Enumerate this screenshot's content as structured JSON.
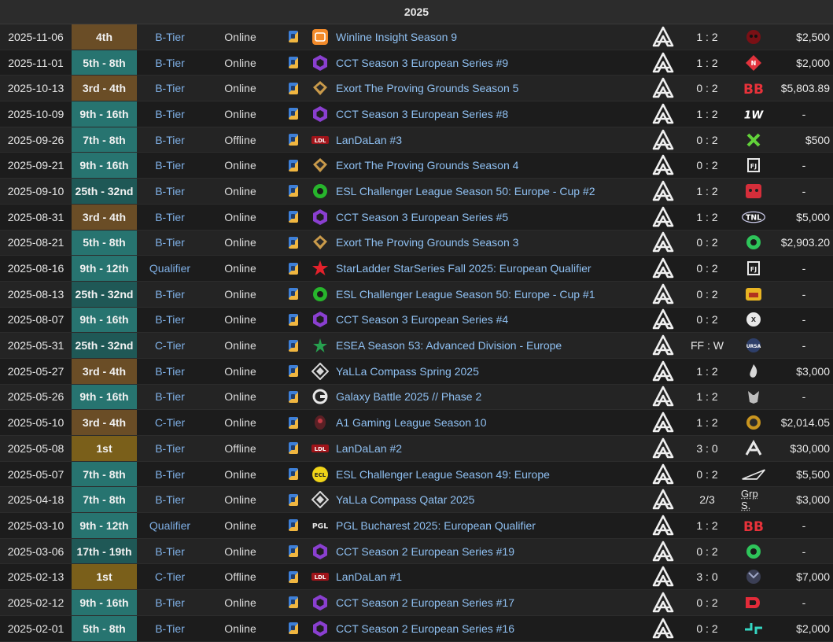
{
  "year": "2025",
  "colors": {
    "gold": "#7a5f1a",
    "bronze": "#6a4d26",
    "teal": "#277470",
    "dark_teal": "#1f5856",
    "link": "#8fc0f2",
    "tier": "#7fb0e6"
  },
  "rows": [
    {
      "date": "2025-11-06",
      "place": "4th",
      "place_style": "bronze",
      "tier": "B-Tier",
      "type": "Online",
      "tournament_icon": "winline-icon",
      "tournament": "Winline Insight Season 9",
      "team_logo": "team-a-logo-icon",
      "score": "1 : 2",
      "opponent_icon": "red-skull-logo-icon",
      "prize": "$2,500"
    },
    {
      "date": "2025-11-01",
      "place": "5th - 8th",
      "place_style": "teal",
      "tier": "B-Tier",
      "type": "Online",
      "tournament_icon": "cct-icon",
      "tournament": "CCT Season 3 European Series #9",
      "team_logo": "team-a-logo-icon",
      "score": "1 : 2",
      "opponent_icon": "red-diamond-logo-icon",
      "prize": "$2,000"
    },
    {
      "date": "2025-10-13",
      "place": "3rd - 4th",
      "place_style": "bronze",
      "tier": "B-Tier",
      "type": "Online",
      "tournament_icon": "exort-icon",
      "tournament": "Exort The Proving Grounds Season 5",
      "team_logo": "team-a-logo-icon",
      "score": "0 : 2",
      "opponent_icon": "bb-logo-icon",
      "prize": "$5,803.89"
    },
    {
      "date": "2025-10-09",
      "place": "9th - 16th",
      "place_style": "teal",
      "tier": "B-Tier",
      "type": "Online",
      "tournament_icon": "cct-icon",
      "tournament": "CCT Season 3 European Series #8",
      "team_logo": "team-a-logo-icon",
      "score": "1 : 2",
      "opponent_icon": "1w-logo-icon",
      "prize": "-"
    },
    {
      "date": "2025-09-26",
      "place": "7th - 8th",
      "place_style": "teal",
      "tier": "B-Tier",
      "type": "Offline",
      "tournament_icon": "landalan-icon",
      "tournament": "LanDaLan #3",
      "team_logo": "team-a-logo-icon",
      "score": "0 : 2",
      "opponent_icon": "green-x-logo-icon",
      "prize": "$500"
    },
    {
      "date": "2025-09-21",
      "place": "9th - 16th",
      "place_style": "teal",
      "tier": "B-Tier",
      "type": "Online",
      "tournament_icon": "exort-icon",
      "tournament": "Exort The Proving Grounds Season 4",
      "team_logo": "team-a-logo-icon",
      "score": "0 : 2",
      "opponent_icon": "fj-logo-icon",
      "prize": "-"
    },
    {
      "date": "2025-09-10",
      "place": "25th - 32nd",
      "place_style": "dark_teal",
      "tier": "B-Tier",
      "type": "Online",
      "tournament_icon": "esl-cl-icon",
      "tournament": "ESL Challenger League Season 50: Europe - Cup #2",
      "team_logo": "team-a-logo-icon",
      "score": "1 : 2",
      "opponent_icon": "red-face-logo-icon",
      "prize": "-"
    },
    {
      "date": "2025-08-31",
      "place": "3rd - 4th",
      "place_style": "bronze",
      "tier": "B-Tier",
      "type": "Online",
      "tournament_icon": "cct-icon",
      "tournament": "CCT Season 3 European Series #5",
      "team_logo": "team-a-logo-icon",
      "score": "1 : 2",
      "opponent_icon": "tnl-logo-icon",
      "prize": "$5,000"
    },
    {
      "date": "2025-08-21",
      "place": "5th - 8th",
      "place_style": "teal",
      "tier": "B-Tier",
      "type": "Online",
      "tournament_icon": "exort-icon",
      "tournament": "Exort The Proving Grounds Season 3",
      "team_logo": "team-a-logo-icon",
      "score": "0 : 2",
      "opponent_icon": "green-b-logo-icon",
      "prize": "$2,903.20"
    },
    {
      "date": "2025-08-16",
      "place": "9th - 12th",
      "place_style": "teal",
      "tier": "Qualifier",
      "type": "Online",
      "tournament_icon": "starladder-icon",
      "tournament": "StarLadder StarSeries Fall 2025: European Qualifier",
      "team_logo": "team-a-logo-icon",
      "score": "0 : 2",
      "opponent_icon": "fj-logo-icon",
      "prize": "-"
    },
    {
      "date": "2025-08-13",
      "place": "25th - 32nd",
      "place_style": "dark_teal",
      "tier": "B-Tier",
      "type": "Online",
      "tournament_icon": "esl-cl-icon",
      "tournament": "ESL Challenger League Season 50: Europe - Cup #1",
      "team_logo": "team-a-logo-icon",
      "score": "0 : 2",
      "opponent_icon": "yellow-logo-icon",
      "prize": "-"
    },
    {
      "date": "2025-08-07",
      "place": "9th - 16th",
      "place_style": "teal",
      "tier": "B-Tier",
      "type": "Online",
      "tournament_icon": "cct-icon",
      "tournament": "CCT Season 3 European Series #4",
      "team_logo": "team-a-logo-icon",
      "score": "0 : 2",
      "opponent_icon": "white-round-logo-icon",
      "prize": "-"
    },
    {
      "date": "2025-05-31",
      "place": "25th - 32nd",
      "place_style": "dark_teal",
      "tier": "C-Tier",
      "type": "Online",
      "tournament_icon": "esea-icon",
      "tournament": "ESEA Season 53: Advanced Division - Europe",
      "team_logo": "team-a-logo-icon",
      "score": "FF : W",
      "opponent_icon": "ursa-logo-icon",
      "prize": "-"
    },
    {
      "date": "2025-05-27",
      "place": "3rd - 4th",
      "place_style": "bronze",
      "tier": "B-Tier",
      "type": "Online",
      "tournament_icon": "yalla-icon",
      "tournament": "YaLLa Compass Spring 2025",
      "team_logo": "team-a-logo-icon",
      "score": "1 : 2",
      "opponent_icon": "flame-logo-icon",
      "prize": "$3,000"
    },
    {
      "date": "2025-05-26",
      "place": "9th - 16th",
      "place_style": "teal",
      "tier": "B-Tier",
      "type": "Online",
      "tournament_icon": "galaxy-icon",
      "tournament": "Galaxy Battle 2025 // Phase 2",
      "team_logo": "team-a-logo-icon",
      "score": "1 : 2",
      "opponent_icon": "wolf-logo-icon",
      "prize": "-"
    },
    {
      "date": "2025-05-10",
      "place": "3rd - 4th",
      "place_style": "bronze",
      "tier": "C-Tier",
      "type": "Online",
      "tournament_icon": "a1-icon",
      "tournament": "A1 Gaming League Season 10",
      "team_logo": "team-a-logo-icon",
      "score": "1 : 2",
      "opponent_icon": "gold-round-logo-icon",
      "prize": "$2,014.05"
    },
    {
      "date": "2025-05-08",
      "place": "1st",
      "place_style": "gold",
      "tier": "B-Tier",
      "type": "Offline",
      "tournament_icon": "landalan-icon",
      "tournament": "LanDaLan #2",
      "team_logo": "team-a-logo-icon",
      "score": "3 : 0",
      "opponent_icon": "ar-logo-icon",
      "prize": "$30,000"
    },
    {
      "date": "2025-05-07",
      "place": "7th - 8th",
      "place_style": "teal",
      "tier": "B-Tier",
      "type": "Online",
      "tournament_icon": "esl-cl-yellow-icon",
      "tournament": "ESL Challenger League Season 49: Europe",
      "team_logo": "team-a-logo-icon",
      "score": "0 : 2",
      "opponent_icon": "wing-logo-icon",
      "prize": "$5,500"
    },
    {
      "date": "2025-04-18",
      "place": "7th - 8th",
      "place_style": "teal",
      "tier": "B-Tier",
      "type": "Online",
      "tournament_icon": "yalla-icon",
      "tournament": "YaLLa Compass Qatar 2025",
      "team_logo": "team-a-logo-icon",
      "score": "2/3",
      "opponent_text": "Grp S.",
      "prize": "$3,000"
    },
    {
      "date": "2025-03-10",
      "place": "9th - 12th",
      "place_style": "teal",
      "tier": "Qualifier",
      "type": "Online",
      "tournament_icon": "pgl-icon",
      "tournament": "PGL Bucharest 2025: European Qualifier",
      "team_logo": "team-a-logo-icon",
      "score": "1 : 2",
      "opponent_icon": "bb-logo-icon",
      "prize": "-"
    },
    {
      "date": "2025-03-06",
      "place": "17th - 19th",
      "place_style": "dark_teal",
      "tier": "B-Tier",
      "type": "Online",
      "tournament_icon": "cct-icon",
      "tournament": "CCT Season 2 European Series #19",
      "team_logo": "team-a-logo-icon",
      "score": "0 : 2",
      "opponent_icon": "green-b-logo-icon",
      "prize": "-"
    },
    {
      "date": "2025-02-13",
      "place": "1st",
      "place_style": "gold",
      "tier": "C-Tier",
      "type": "Offline",
      "tournament_icon": "landalan-icon",
      "tournament": "LanDaLan #1",
      "team_logo": "team-a-logo-icon",
      "score": "3 : 0",
      "opponent_icon": "dark-beast-logo-icon",
      "prize": "$7,000"
    },
    {
      "date": "2025-02-12",
      "place": "9th - 16th",
      "place_style": "teal",
      "tier": "B-Tier",
      "type": "Online",
      "tournament_icon": "cct-icon",
      "tournament": "CCT Season 2 European Series #17",
      "team_logo": "team-a-logo-icon",
      "score": "0 : 2",
      "opponent_icon": "red-d-logo-icon",
      "prize": "-"
    },
    {
      "date": "2025-02-01",
      "place": "5th - 8th",
      "place_style": "teal",
      "tier": "B-Tier",
      "type": "Online",
      "tournament_icon": "cct-icon",
      "tournament": "CCT Season 2 European Series #16",
      "team_logo": "team-a-logo-icon",
      "score": "0 : 2",
      "opponent_icon": "teal-arrows-logo-icon",
      "prize": "$2,000"
    }
  ]
}
